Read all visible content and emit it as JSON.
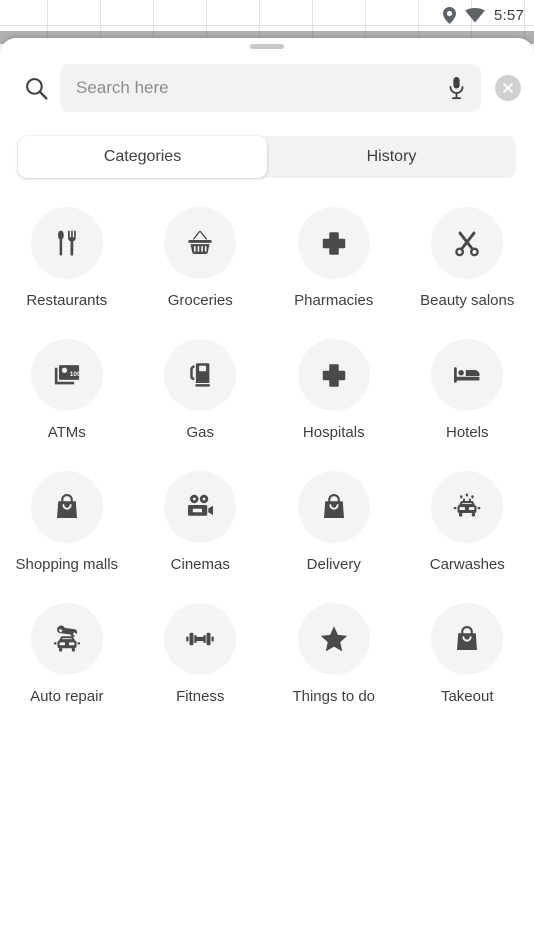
{
  "status_bar": {
    "location_icon": "location-pin-icon",
    "wifi_icon": "wifi-icon",
    "time": "5:57"
  },
  "sheet": {
    "handle": "drag-handle"
  },
  "search": {
    "search_icon": "search-icon",
    "placeholder": "Search here",
    "value": "",
    "mic_icon": "microphone-icon",
    "clear_icon": "close-icon"
  },
  "tabs": [
    {
      "label": "Categories",
      "selected": true
    },
    {
      "label": "History",
      "selected": false
    }
  ],
  "categories": [
    {
      "label": "Restaurants",
      "icon": "restaurant-icon"
    },
    {
      "label": "Groceries",
      "icon": "shopping-basket-icon"
    },
    {
      "label": "Pharmacies",
      "icon": "medical-cross-icon"
    },
    {
      "label": "Beauty salons",
      "icon": "scissors-icon"
    },
    {
      "label": "ATMs",
      "icon": "banknotes-icon"
    },
    {
      "label": "Gas",
      "icon": "fuel-pump-icon"
    },
    {
      "label": "Hospitals",
      "icon": "medical-cross-icon"
    },
    {
      "label": "Hotels",
      "icon": "bed-icon"
    },
    {
      "label": "Shopping malls",
      "icon": "shopping-bag-icon"
    },
    {
      "label": "Cinemas",
      "icon": "movie-camera-icon"
    },
    {
      "label": "Delivery",
      "icon": "shopping-bag-icon"
    },
    {
      "label": "Carwashes",
      "icon": "carwash-icon"
    },
    {
      "label": "Auto repair",
      "icon": "car-wrench-icon"
    },
    {
      "label": "Fitness",
      "icon": "dumbbell-icon"
    },
    {
      "label": "Things to do",
      "icon": "star-icon"
    },
    {
      "label": "Takeout",
      "icon": "shopping-bag-icon"
    }
  ],
  "colors": {
    "sheet_background": "#ffffff",
    "field_background": "#f2f2f2",
    "circle_background": "#f4f4f4",
    "text_primary": "#3c4043",
    "icon_fill": "#4a4a4a",
    "map_grid_line": "#e3e3e3",
    "map_scrim": "#b0b0b0"
  }
}
